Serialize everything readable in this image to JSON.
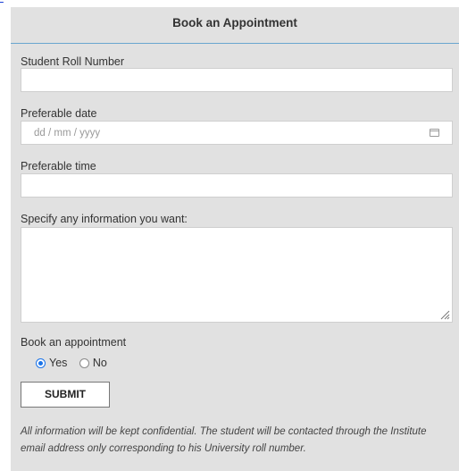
{
  "form": {
    "title": "Book an Appointment",
    "roll_label": "Student Roll Number",
    "roll_value": "",
    "date_label": "Preferable date",
    "date_placeholder": "dd / mm / yyyy",
    "time_label": "Preferable time",
    "time_value": "",
    "info_label": "Specify any information you want:",
    "info_value": "",
    "book_label": "Book an appointment",
    "options": [
      {
        "label": "Yes",
        "selected": true
      },
      {
        "label": "No",
        "selected": false
      }
    ],
    "submit_label": "SUBMIT",
    "note": "All information will be kept confidential. The student will be contacted through the Institute email address only corresponding to his University roll number."
  },
  "icons": {
    "date_picker": "calendar-icon",
    "textarea_resize": "resize-handle-icon"
  },
  "colors": {
    "panel": "#e1e1e1",
    "header_rule": "#6aa6cf",
    "radio_selected": "#1a73e8",
    "link": "#1a3fd6"
  }
}
